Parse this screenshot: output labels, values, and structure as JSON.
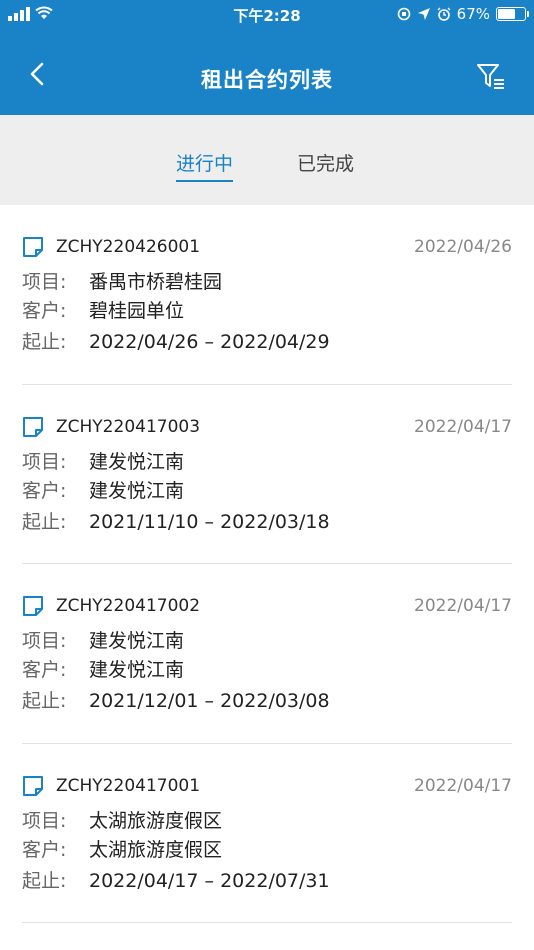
{
  "status_bar": {
    "time": "下午2:28",
    "battery_percent": "67%",
    "battery_level": 0.67
  },
  "nav": {
    "title": "租出合约列表"
  },
  "tabs": [
    {
      "label": "进行中",
      "active": true
    },
    {
      "label": "已完成",
      "active": false
    }
  ],
  "labels": {
    "project": "项目:",
    "client": "客户:",
    "period": "起止:"
  },
  "contracts": [
    {
      "code": "ZCHY220426001",
      "date": "2022/04/26",
      "project": "番禺市桥碧桂园",
      "client": "碧桂园单位",
      "period": "2022/04/26 – 2022/04/29"
    },
    {
      "code": "ZCHY220417003",
      "date": "2022/04/17",
      "project": "建发悦江南",
      "client": "建发悦江南",
      "period": "2021/11/10 – 2022/03/18"
    },
    {
      "code": "ZCHY220417002",
      "date": "2022/04/17",
      "project": "建发悦江南",
      "client": "建发悦江南",
      "period": "2021/12/01 – 2022/03/08"
    },
    {
      "code": "ZCHY220417001",
      "date": "2022/04/17",
      "project": "太湖旅游度假区",
      "client": "太湖旅游度假区",
      "period": "2022/04/17 – 2022/07/31"
    }
  ],
  "colors": {
    "primary": "#1a82c7",
    "tab_bg": "#eeeeee",
    "divider": "#e3e3e3"
  },
  "icons": {
    "back": "chevron-left-icon",
    "filter": "filter-list-icon",
    "document": "document-icon"
  }
}
